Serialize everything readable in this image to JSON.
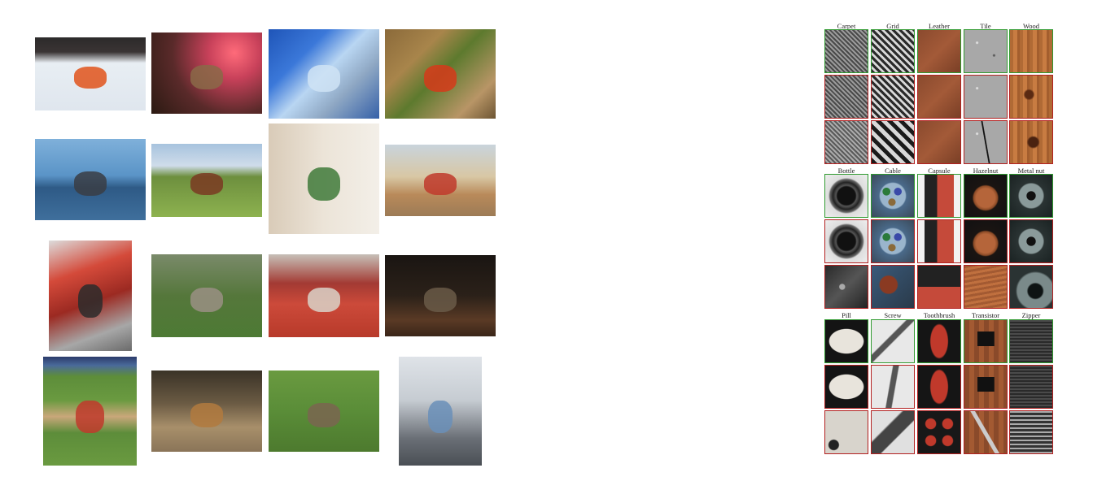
{
  "left_photos": [
    {
      "name": "snowmobile-photo",
      "style": {
        "bg": "linear-gradient(180deg,#2c2a2a 0%,#3a3434 20%,#e8eef3 35%,#dfe6ee 100%)",
        "accent": "#e0541b"
      }
    },
    {
      "name": "red-light-photo",
      "style": {
        "bg": "radial-gradient(circle at 75% 25%,#ff6b7a 0%,#c8415a 25%,#5a2a2a 60%,#2b1a12 100%)",
        "accent": "#8a6a48"
      }
    },
    {
      "name": "glass-dish-photo",
      "style": {
        "bg": "linear-gradient(135deg,#1f55b8 0%,#3b78d9 30%,#b9d6f2 50%,#8fa8c4 70%,#3560a8 100%)",
        "accent": "#cfe3f5"
      }
    },
    {
      "name": "ladybug-photo",
      "style": {
        "bg": "linear-gradient(135deg,#8b6a3a 0%,#a8854b 30%,#5d7a2e 50%,#b89566 80%,#6d5533 100%)",
        "accent": "#d63a1a"
      }
    },
    {
      "name": "whale-mural-photo",
      "style": {
        "bg": "linear-gradient(180deg,#7fb0da 0%,#5a94c7 45%,#2e5a86 60%,#3f6f9c 100%)",
        "accent": "#3a3d44"
      }
    },
    {
      "name": "horse-carriage-field-photo",
      "style": {
        "bg": "linear-gradient(180deg,#a7c3de 0%,#cfdcea 30%,#6d8f3e 45%,#8db24f 100%)",
        "accent": "#7a3a22"
      }
    },
    {
      "name": "room-palm-photo",
      "style": {
        "bg": "linear-gradient(90deg,#d9cbb8 0%,#ece4d8 50%,#f3efe8 100%)",
        "accent": "#3f7a3a"
      }
    },
    {
      "name": "horse-cart-road-photo",
      "style": {
        "bg": "linear-gradient(180deg,#c9d4dc 0%,#d8c7a4 45%,#b98a5a 70%,#9c7b56 100%)",
        "accent": "#c0392b"
      }
    },
    {
      "name": "band-drums-photo",
      "style": {
        "bg": "linear-gradient(160deg,#dcdcdc 0%,#d44a3a 30%,#9c2a22 55%,#a7a7a7 80%,#6a6a6a 100%)",
        "accent": "#2b2b2b"
      }
    },
    {
      "name": "weimaraner-photo",
      "style": {
        "bg": "linear-gradient(180deg,#7a8a6a 0%,#55773b 50%,#4d7a34 100%)",
        "accent": "#9a8f84"
      }
    },
    {
      "name": "crowd-stands-photo",
      "style": {
        "bg": "linear-gradient(180deg,#c7c0b8 0%,#a33a33 35%,#cc4a3a 60%,#b83a2a 100%)",
        "accent": "#d9d2c8"
      }
    },
    {
      "name": "night-carriage-photo",
      "style": {
        "bg": "linear-gradient(180deg,#1a1512 0%,#2b2119 50%,#5a3a25 80%,#3a2618 100%)",
        "accent": "#6a5a48"
      }
    },
    {
      "name": "baseball-field-photo",
      "style": {
        "bg": "linear-gradient(180deg,#2b3a6a 0%,#4a6a9a 8%,#5d8d3a 18%,#6a9a40 40%,#c9a77a 55%,#5d8d3a 70%,#6a9a40 100%)",
        "accent": "#c0392b"
      }
    },
    {
      "name": "dog-sitting-photo",
      "style": {
        "bg": "linear-gradient(180deg,#3a3327 0%,#6a5a43 40%,#a88f6a 70%,#8a7458 100%)",
        "accent": "#b27a3e"
      }
    },
    {
      "name": "bird-grass-photo",
      "style": {
        "bg": "linear-gradient(180deg,#6a9a40 0%,#5a8d38 50%,#4d7a2e 100%)",
        "accent": "#7a6550"
      }
    },
    {
      "name": "hiker-backpack-photo",
      "style": {
        "bg": "linear-gradient(180deg,#dfe3e8 0%,#c6ccd2 40%,#6a6f76 75%,#4a4f55 100%)",
        "accent": "#6a8fb8"
      }
    }
  ],
  "mvtec": {
    "groups": [
      {
        "labels": [
          "Carpet",
          "Grid",
          "Leather",
          "Tile",
          "Wood"
        ]
      },
      {
        "labels": [
          "Bottle",
          "Cable",
          "Capsule",
          "Hazelnut",
          "Metal nut"
        ]
      },
      {
        "labels": [
          "Pill",
          "Screw",
          "Toothbrush",
          "Transistor",
          "Zipper"
        ]
      }
    ],
    "tiles": [
      {
        "name": "carpet-normal",
        "status": "ok",
        "bg": "repeating-linear-gradient(45deg,#4a4a4a 0 2px,#9a9a9a 2px 4px),#6a6a6a"
      },
      {
        "name": "grid-normal",
        "status": "ok",
        "bg": "repeating-linear-gradient(45deg,#2a2a2a 0 3px,#d8d8d8 3px 6px),repeating-linear-gradient(-45deg,#2a2a2a 0 3px,transparent 3px 6px)"
      },
      {
        "name": "leather-normal",
        "status": "ok",
        "bg": "linear-gradient(135deg,#8a4a2e,#a35a38 50%,#7a3f26)"
      },
      {
        "name": "tile-normal",
        "status": "ok",
        "bg": "radial-gradient(circle at 30% 30%,#e0e0e0 0 1px,transparent 2px),radial-gradient(circle at 70% 60%,#5a5a5a 0 1px,transparent 2px),#a8a8a8"
      },
      {
        "name": "wood-normal",
        "status": "ok",
        "bg": "repeating-linear-gradient(90deg,#b06a35 0 4px,#c87c42 4px 9px,#a35e2e 9px 12px)"
      },
      {
        "name": "carpet-defect-a",
        "status": "bad",
        "bg": "repeating-linear-gradient(45deg,#4a4a4a 0 2px,#9a9a9a 2px 4px),#6a6a6a"
      },
      {
        "name": "grid-defect-a",
        "status": "bad",
        "bg": "repeating-linear-gradient(45deg,#2a2a2a 0 3px,#d8d8d8 3px 6px),repeating-linear-gradient(-45deg,#2a2a2a 0 3px,transparent 3px 6px)"
      },
      {
        "name": "leather-defect-a",
        "status": "bad",
        "bg": "linear-gradient(135deg,#8a4a2e,#a35a38 50%,#7a3f26)"
      },
      {
        "name": "tile-defect-a",
        "status": "bad",
        "bg": "radial-gradient(circle at 30% 30%,#e0e0e0 0 1px,transparent 2px),#a8a8a8"
      },
      {
        "name": "wood-defect-a",
        "status": "bad",
        "bg": "radial-gradient(circle at 45% 45%,#5a2a12 0 5px,transparent 7px),repeating-linear-gradient(90deg,#b06a35 0 4px,#c87c42 4px 9px,#a35e2e 9px 12px)"
      },
      {
        "name": "carpet-defect-b",
        "status": "bad",
        "bg": "repeating-linear-gradient(45deg,#5a5a5a 0 2px,#aaaaaa 2px 4px),#7a7a7a"
      },
      {
        "name": "grid-defect-b",
        "status": "bad",
        "bg": "repeating-linear-gradient(45deg,#1a1a1a 0 5px,#d8d8d8 5px 10px),repeating-linear-gradient(-45deg,#1a1a1a 0 5px,transparent 5px 10px)"
      },
      {
        "name": "leather-defect-b",
        "status": "bad",
        "bg": "linear-gradient(135deg,#8a4a2e,#a35a38 50%,#7a3f26)"
      },
      {
        "name": "tile-defect-b",
        "status": "bad",
        "bg": "linear-gradient(80deg,transparent 48%,#111 49% 51%,transparent 52%),radial-gradient(circle at 30% 30%,#e0e0e0 0 1px,transparent 2px),#a8a8a8"
      },
      {
        "name": "wood-defect-b",
        "status": "bad",
        "bg": "radial-gradient(circle at 55% 50%,#4a2210 0 6px,transparent 8px),repeating-linear-gradient(90deg,#b06a35 0 4px,#c87c42 4px 9px,#a35e2e 9px 12px)"
      },
      {
        "name": "bottle-normal",
        "status": "ok",
        "bg": "radial-gradient(circle,#111 0 30%,#555 35%,#222 45%,#666 55%,#ddd 60%,#eee 100%)"
      },
      {
        "name": "cable-normal",
        "status": "ok",
        "bg": "radial-gradient(circle at 35% 40%,#2a7a3a 0 10%,transparent 11%),radial-gradient(circle at 62% 40%,#3a4aa8 0 10%,transparent 11%),radial-gradient(circle at 48% 65%,#8a6a3a 0 10%,transparent 11%),radial-gradient(circle,#9ab5cc 0 42%,#4a6a8a 46%,#3a4a5a 100%)"
      },
      {
        "name": "capsule-normal",
        "status": "ok",
        "bg": "linear-gradient(90deg,transparent 15%,#222 15% 45%,#c54a3a 45% 85%,transparent 85%),#f2f2f2"
      },
      {
        "name": "hazelnut-normal",
        "status": "ok",
        "bg": "radial-gradient(circle at 50% 55%,#b5653a 0 30%,#8a4a26 38%,#1a1412 42%,#111 100%)"
      },
      {
        "name": "metalnut-normal",
        "status": "ok",
        "bg": "radial-gradient(circle,#111 0 15%,#8a9a9a 16% 40%,#2a3333 44%,#1a2222 100%)"
      },
      {
        "name": "bottle-defect-a",
        "status": "bad",
        "bg": "radial-gradient(circle,#111 0 30%,#555 35%,#222 45%,#666 55%,#ddd 60%,#eee 100%)"
      },
      {
        "name": "cable-defect-a",
        "status": "bad",
        "bg": "radial-gradient(circle at 35% 40%,#2a7a3a 0 10%,transparent 11%),radial-gradient(circle at 62% 40%,#3a4aa8 0 10%,transparent 11%),radial-gradient(circle at 48% 65%,#8a6a3a 0 10%,transparent 11%),radial-gradient(circle,#9ab5cc 0 42%,#4a6a8a 46%,#3a4a5a 100%)"
      },
      {
        "name": "capsule-defect-a",
        "status": "bad",
        "bg": "linear-gradient(90deg,transparent 15%,#222 15% 45%,#c54a3a 45% 85%,transparent 85%),#f2f2f2"
      },
      {
        "name": "hazelnut-defect-a",
        "status": "bad",
        "bg": "radial-gradient(circle at 50% 55%,#b5653a 0 30%,#8a4a26 38%,#1a1412 42%,#111 100%)"
      },
      {
        "name": "metalnut-defect-a",
        "status": "bad",
        "bg": "radial-gradient(circle,#111 0 15%,#8a9a9a 16% 40%,#2a3333 44%,#1a2222 100%)"
      },
      {
        "name": "bottle-defect-b",
        "status": "bad",
        "bg": "radial-gradient(circle at 40% 50%,#aaa 0 8%,transparent 10%),linear-gradient(135deg,#2a2a2a,#555 50%,#222)"
      },
      {
        "name": "cable-defect-b",
        "status": "bad",
        "bg": "radial-gradient(circle at 40% 45%,#8a3a22 0 25%,transparent 28%),linear-gradient(135deg,#3a5a7a,#2a3a4a)"
      },
      {
        "name": "capsule-defect-b",
        "status": "bad",
        "bg": "linear-gradient(180deg,#222 0 50%,#c54a3a 50% 100%)"
      },
      {
        "name": "hazelnut-defect-b",
        "status": "bad",
        "bg": "repeating-linear-gradient(170deg,#a35a32 0 3px,#c0703f 3px 6px)"
      },
      {
        "name": "metalnut-defect-b",
        "status": "bad",
        "bg": "radial-gradient(circle at 60% 60%,#0e1414 0 20%,#7a8a8a 24% 50%,#2a3333 55%)"
      },
      {
        "name": "pill-normal",
        "status": "ok",
        "bg": "radial-gradient(ellipse 42% 30% at 50% 50%,#e8e4dc 0 95%,transparent 100%),#141414"
      },
      {
        "name": "screw-normal",
        "status": "ok",
        "bg": "linear-gradient(135deg,transparent 40%,#555 42% 50%,transparent 52%),#e8e8e8"
      },
      {
        "name": "toothbrush-normal",
        "status": "ok",
        "bg": "radial-gradient(ellipse 22% 42% at 50% 50%,#c0392b 0 90%,transparent 100%),#151515"
      },
      {
        "name": "transistor-normal",
        "status": "ok",
        "bg": "linear-gradient(#111,#111) 50% 40%/40% 35% no-repeat,repeating-linear-gradient(90deg,#8a4a2a 0 6px,#a35a32 6px 12px)"
      },
      {
        "name": "zipper-normal",
        "status": "ok",
        "bg": "repeating-linear-gradient(180deg,#4a4a4a 0 2px,#2a2a2a 2px 4px),#333"
      },
      {
        "name": "pill-defect-a",
        "status": "bad",
        "bg": "radial-gradient(ellipse 42% 30% at 50% 50%,#e8e4dc 0 95%,transparent 100%),#141414"
      },
      {
        "name": "screw-defect-a",
        "status": "bad",
        "bg": "linear-gradient(100deg,transparent 42%,#555 44% 54%,transparent 56%),#e8e8e8"
      },
      {
        "name": "toothbrush-defect-a",
        "status": "bad",
        "bg": "radial-gradient(ellipse 22% 42% at 50% 50%,#c0392b 0 90%,transparent 100%),#151515"
      },
      {
        "name": "transistor-defect-a",
        "status": "bad",
        "bg": "linear-gradient(#111,#111) 50% 40%/40% 35% no-repeat,repeating-linear-gradient(90deg,#8a4a2a 0 6px,#a35a32 6px 12px)"
      },
      {
        "name": "zipper-defect-a",
        "status": "bad",
        "bg": "repeating-linear-gradient(180deg,#4a4a4a 0 2px,#2a2a2a 2px 4px),#333"
      },
      {
        "name": "pill-defect-b",
        "status": "bad",
        "bg": "radial-gradient(circle at 20% 80%,#222 0 10%,transparent 12%),#d8d4cc"
      },
      {
        "name": "screw-defect-b",
        "status": "bad",
        "bg": "linear-gradient(135deg,transparent 35%,#444 38% 60%,transparent 62%),#e0e0e0"
      },
      {
        "name": "toothbrush-defect-b",
        "status": "bad",
        "bg": "radial-gradient(circle at 30% 30%,#c0392b 0 12%,transparent 14%),radial-gradient(circle at 70% 30%,#c0392b 0 12%,transparent 14%),radial-gradient(circle at 30% 70%,#c0392b 0 12%,transparent 14%),radial-gradient(circle at 70% 70%,#c0392b 0 12%,transparent 14%),#181818"
      },
      {
        "name": "transistor-defect-b",
        "status": "bad",
        "bg": "linear-gradient(60deg,transparent 45%,#ccc 46% 52%,transparent 53%),repeating-linear-gradient(90deg,#8a4a2a 0 6px,#a35a32 6px 12px)"
      },
      {
        "name": "zipper-defect-b",
        "status": "bad",
        "bg": "repeating-linear-gradient(180deg,#aaa 0 2px,#333 2px 5px),#444"
      }
    ],
    "colors": {
      "ok": "#2f9a2f",
      "bad": "#b32020"
    }
  }
}
